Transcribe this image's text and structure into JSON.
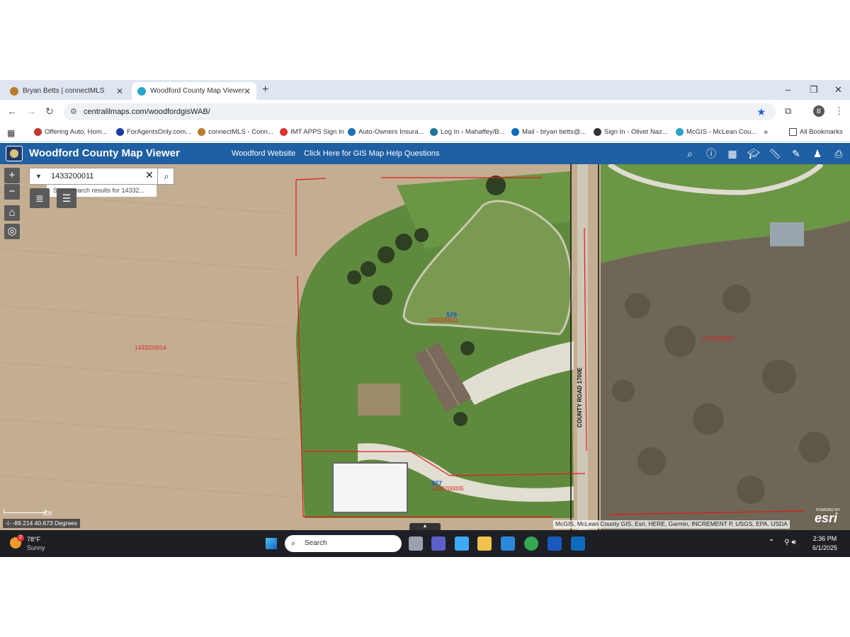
{
  "browser": {
    "tabs": [
      {
        "label": "Bryan Betts | connectMLS",
        "color": "#b87a2b"
      },
      {
        "label": "Woodford County Map Viewer",
        "color": "#2aa4c7"
      }
    ],
    "new_tab": "+",
    "window_buttons": {
      "minimize": "–",
      "maximize": "❐",
      "close": "✕"
    },
    "url": "centralilmaps.com/woodfordgisWAB/",
    "bookmarks": [
      {
        "label": "Offering Auto, Hom...",
        "color": "#c0392b"
      },
      {
        "label": "ForAgentsOnly.com...",
        "color": "#1a3e9c"
      },
      {
        "label": "connectMLS - Conn...",
        "color": "#b87a2b"
      },
      {
        "label": "IMT APPS Sign In",
        "color": "#d33"
      },
      {
        "label": "Auto-Owners Insura...",
        "color": "#1e6fb8"
      },
      {
        "label": "Log In ‹ Mahaffey/B...",
        "color": "#21759b"
      },
      {
        "label": "Mail - bryan betts@...",
        "color": "#0f6cbd"
      },
      {
        "label": "Sign In - Olivet Naz...",
        "color": "#333"
      },
      {
        "label": "McGIS - McLean Cou...",
        "color": "#2aa4c7"
      }
    ],
    "bookmarks_more": "»",
    "all_bookmarks": "All Bookmarks"
  },
  "app": {
    "title": "Woodford County Map Viewer",
    "links": [
      "Woodford Website",
      "Click Here for GIS Map Help Questions"
    ],
    "tools": [
      "search-icon",
      "info-icon",
      "basemap-gallery-icon",
      "learn-icon",
      "measure-icon",
      "draw-icon",
      "streetview-icon",
      "print-icon"
    ]
  },
  "map": {
    "search": {
      "value": "1433200011",
      "suggestion": "Show search results for 14332..."
    },
    "parcels": [
      {
        "id": "1433200014"
      },
      {
        "id": "1433200011"
      },
      {
        "id": "1434100005"
      },
      {
        "id": "1433200005"
      }
    ],
    "addresses": [
      "579",
      "577"
    ],
    "road_label": "COUNTY ROAD 1700E",
    "scale_label": "60ft",
    "coordinates": "-89.214 40.673 Degrees",
    "attribution": "McGIS, McLean County GIS, Esri, HERE, Garmin, INCREMENT P, USGS, EPA, USDA",
    "esri": "esri",
    "powered": "POWERED BY"
  },
  "taskbar": {
    "temp": "78°F",
    "condition": "Sunny",
    "weather_badge": "2",
    "search_label": "Search",
    "time": "2:36 PM",
    "date": "6/1/2025",
    "apps": [
      {
        "name": "task-view",
        "color": "#9aa3ad"
      },
      {
        "name": "teams",
        "color": "#5b5fc7"
      },
      {
        "name": "copilot",
        "color": "#3fa9f5"
      },
      {
        "name": "file-explorer",
        "color": "#f2c14e"
      },
      {
        "name": "store",
        "color": "#2b88d8"
      },
      {
        "name": "chrome",
        "color": "#34a853"
      },
      {
        "name": "word",
        "color": "#185abd"
      },
      {
        "name": "outlook",
        "color": "#0f6cbd"
      }
    ]
  }
}
